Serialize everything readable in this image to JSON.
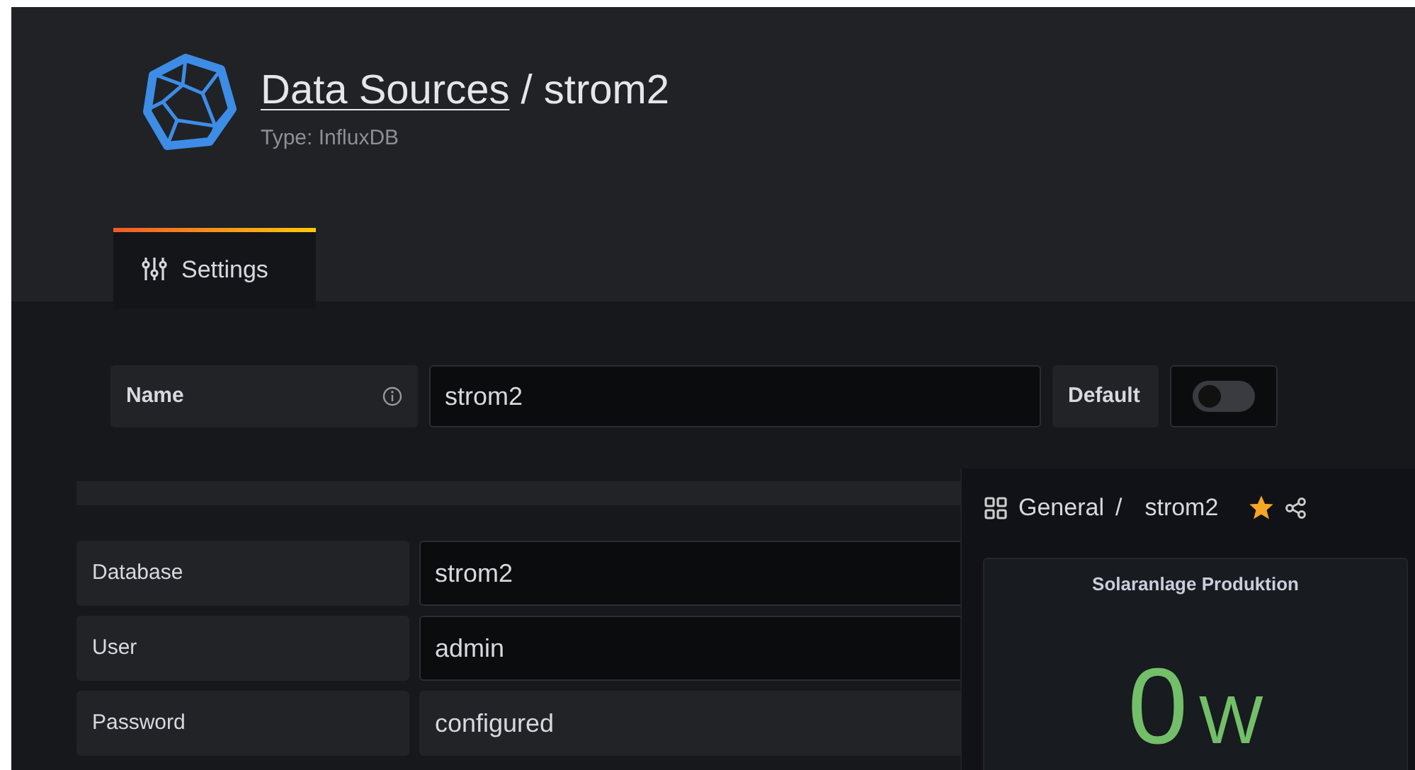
{
  "header": {
    "breadcrumb_link": "Data Sources",
    "separator": "/",
    "title": "strom2",
    "subtitle": "Type: InfluxDB"
  },
  "tabs": [
    {
      "label": "Settings",
      "selected": true
    }
  ],
  "name_field": {
    "label": "Name",
    "value": "strom2",
    "default_label": "Default",
    "default_on": false
  },
  "fields": [
    {
      "label": "Database",
      "value": "strom2",
      "kind": "text"
    },
    {
      "label": "User",
      "value": "admin",
      "kind": "text"
    },
    {
      "label": "Password",
      "value": "configured",
      "kind": "configured"
    }
  ],
  "dashboard": {
    "folder": "General",
    "separator": "/",
    "title": "strom2",
    "starred": true,
    "panel": {
      "title": "Solaranlage Produktion",
      "value": "0",
      "unit": "W"
    }
  }
}
